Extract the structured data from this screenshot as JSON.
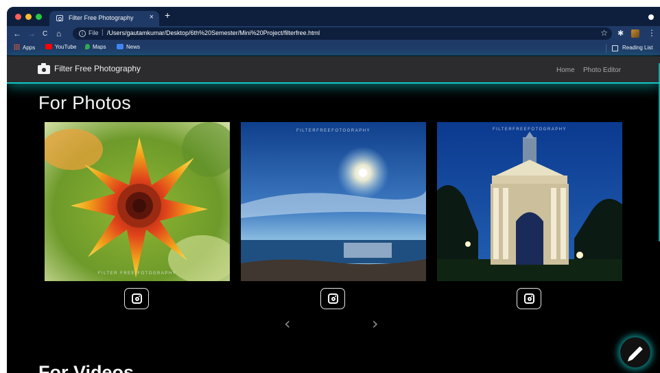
{
  "browser": {
    "tab_title": "Filter Free Photography",
    "tab_close": "×",
    "new_tab": "+",
    "url_scheme": "File",
    "url_separator": "|",
    "url": "/Users/gautamkumar/Desktop/6th%20Semester/Mini%20Project/filterfree.html",
    "back": "←",
    "forward": "→",
    "reload": "C",
    "home": "⌂",
    "star": "☆",
    "extensions": "✱",
    "menu": "⋮",
    "bookmarks": [
      {
        "label": "Apps",
        "icon": "apps-grid-icon"
      },
      {
        "label": "YouTube",
        "icon": "youtube-icon",
        "color": "#ff0000"
      },
      {
        "label": "Maps",
        "icon": "maps-icon",
        "color": "#34a853"
      },
      {
        "label": "News",
        "icon": "news-icon",
        "color": "#4285f4"
      }
    ],
    "reading_list": "Reading List"
  },
  "site": {
    "brand": "Filter Free Photography",
    "nav": [
      {
        "label": "Home"
      },
      {
        "label": "Photo Editor"
      }
    ],
    "section_title": "For Photos",
    "next_section_title": "For Videos",
    "photos": [
      {
        "subject": "flower",
        "watermark": "FILTER FREE FOTOGRAPHY"
      },
      {
        "subject": "sea-sunset",
        "watermark": "FILTERFREEFOTOGRAPHY"
      },
      {
        "subject": "monument-night",
        "watermark": "FILTERFREEFOTOGRAPHY"
      }
    ],
    "prev_arrow": "‹",
    "next_arrow": "›",
    "accent_color": "#15c6c6"
  }
}
